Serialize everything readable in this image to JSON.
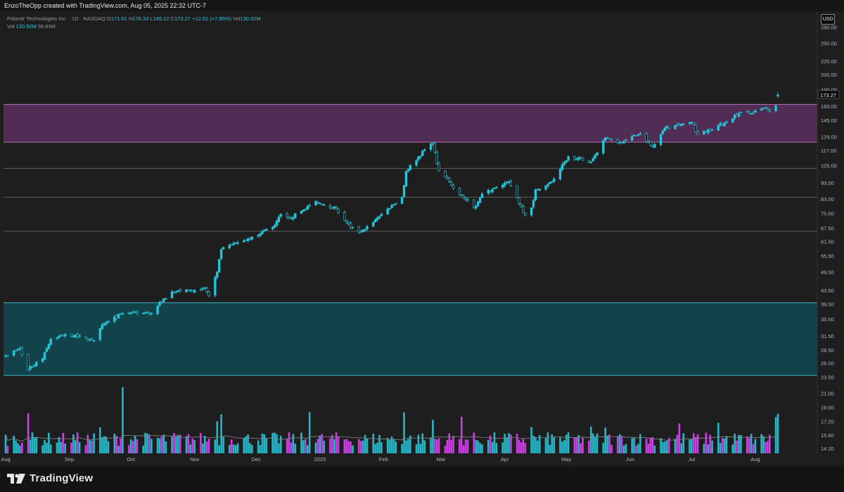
{
  "header": {
    "attribution": "EnzoTheOpp created with TradingView.com, Aug 05, 2025 22:32 UTC-7"
  },
  "legend": {
    "symbol": "Palantir Technologies Inc. · 1D · NASDAQ",
    "open_label": "O",
    "open": "171.81",
    "high_label": "H",
    "high": "176.33",
    "low_label": "L",
    "low": "169.22",
    "close_label": "C",
    "close": "173.27",
    "change": "+12.61 (+7.85%)",
    "vol_label": "Vol",
    "vol": "130.92M",
    "vol2_label": "Vol",
    "vol2": "130.92M",
    "vol_ma": "59.83M"
  },
  "currency": "USD",
  "last_price": "173.27",
  "footer": {
    "brand": "TradingView"
  },
  "colors": {
    "up": "#26c6da",
    "down": "#26c6da",
    "vol_up": "#26c6da",
    "vol_down": "#e040fb",
    "zone_top": "#5b2f5e",
    "zone_bottom": "#124a52",
    "level_line": "#5e5e5e"
  },
  "chart_data": {
    "type": "candlestick",
    "y_scale": "log",
    "y_ticks": [
      280.0,
      250.0,
      220.0,
      200.0,
      180.0,
      160.0,
      145.0,
      129.0,
      117.0,
      105.0,
      93.0,
      83.0,
      75.0,
      67.5,
      61.5,
      55.5,
      49.5,
      43.5,
      39.5,
      35.5,
      31.5,
      28.5,
      26.0,
      23.5,
      21.0,
      19.0,
      17.2,
      15.6,
      14.2
    ],
    "y_tick_labels": [
      "280.00",
      "250.00",
      "220.00",
      "200.00",
      "180.00",
      "160.00",
      "145.00",
      "129.00",
      "117.00",
      "105.00",
      "93.00",
      "83.00",
      "75.00",
      "67.50",
      "61.50",
      "55.50",
      "49.50",
      "43.50",
      "39.50",
      "35.50",
      "31.50",
      "28.50",
      "26.00",
      "23.50",
      "21.00",
      "19.00",
      "17.20",
      "15.60",
      "14.20"
    ],
    "x_labels": [
      "Aug",
      "Sep",
      "Oct",
      "Nov",
      "Dec",
      "2025",
      "Feb",
      "Mar",
      "Apr",
      "May",
      "Jun",
      "Jul",
      "Aug"
    ],
    "x_label_days": [
      0,
      31,
      61,
      92,
      122,
      153,
      184,
      212,
      243,
      273,
      304,
      334,
      365
    ],
    "date_range": [
      "2024-07-25",
      "2025-08-05"
    ],
    "zones": [
      {
        "low": 124,
        "high": 162
      },
      {
        "low": 23.8,
        "high": 39.8
      }
    ],
    "levels": [
      103,
      84,
      66
    ],
    "key_points": [
      {
        "date": "2024-07-25",
        "close": 27.3
      },
      {
        "date": "2024-08-01",
        "close": 28.8
      },
      {
        "date": "2024-08-05",
        "close": 24.9
      },
      {
        "date": "2024-08-12",
        "close": 26.8
      },
      {
        "date": "2024-08-16",
        "close": 30.8
      },
      {
        "date": "2024-08-23",
        "close": 31.8
      },
      {
        "date": "2024-08-30",
        "close": 31.5
      },
      {
        "date": "2024-09-06",
        "close": 30.5
      },
      {
        "date": "2024-09-10",
        "close": 34.0
      },
      {
        "date": "2024-09-20",
        "close": 36.9
      },
      {
        "date": "2024-10-04",
        "close": 37.0
      },
      {
        "date": "2024-10-10",
        "close": 41.0
      },
      {
        "date": "2024-10-14",
        "close": 43.0
      },
      {
        "date": "2024-10-25",
        "close": 43.5
      },
      {
        "date": "2024-10-30",
        "close": 44.2
      },
      {
        "date": "2024-11-01",
        "close": 41.8
      },
      {
        "date": "2024-11-05",
        "close": 49.5
      },
      {
        "date": "2024-11-07",
        "close": 58.0
      },
      {
        "date": "2024-11-22",
        "close": 63.5
      },
      {
        "date": "2024-12-03",
        "close": 68.8
      },
      {
        "date": "2024-12-06",
        "close": 74.5
      },
      {
        "date": "2024-12-10",
        "close": 72.0
      },
      {
        "date": "2024-12-23",
        "close": 81.5
      },
      {
        "date": "2025-01-02",
        "close": 77.5
      },
      {
        "date": "2025-01-09",
        "close": 67.7
      },
      {
        "date": "2025-01-14",
        "close": 65.5
      },
      {
        "date": "2025-01-24",
        "close": 74.5
      },
      {
        "date": "2025-02-03",
        "close": 84.0
      },
      {
        "date": "2025-02-05",
        "close": 101.0
      },
      {
        "date": "2025-02-14",
        "close": 117.5
      },
      {
        "date": "2025-02-18",
        "close": 123.0
      },
      {
        "date": "2025-02-21",
        "close": 101.0
      },
      {
        "date": "2025-03-04",
        "close": 85.0
      },
      {
        "date": "2025-03-10",
        "close": 78.0
      },
      {
        "date": "2025-03-14",
        "close": 86.0
      },
      {
        "date": "2025-03-21",
        "close": 90.0
      },
      {
        "date": "2025-03-27",
        "close": 94.0
      },
      {
        "date": "2025-04-04",
        "close": 74.0
      },
      {
        "date": "2025-04-07",
        "close": 78.0
      },
      {
        "date": "2025-04-09",
        "close": 88.5
      },
      {
        "date": "2025-04-17",
        "close": 93.8
      },
      {
        "date": "2025-04-25",
        "close": 112.0
      },
      {
        "date": "2025-05-06",
        "close": 108.0
      },
      {
        "date": "2025-05-13",
        "close": 128.0
      },
      {
        "date": "2025-05-20",
        "close": 124.0
      },
      {
        "date": "2025-05-30",
        "close": 131.8
      },
      {
        "date": "2025-06-05",
        "close": 119.9
      },
      {
        "date": "2025-06-11",
        "close": 137.0
      },
      {
        "date": "2025-06-18",
        "close": 140.0
      },
      {
        "date": "2025-06-24",
        "close": 143.0
      },
      {
        "date": "2025-06-27",
        "close": 130.6
      },
      {
        "date": "2025-07-10",
        "close": 142.0
      },
      {
        "date": "2025-07-18",
        "close": 153.5
      },
      {
        "date": "2025-07-23",
        "close": 152.0
      },
      {
        "date": "2025-07-30",
        "close": 157.9
      },
      {
        "date": "2025-08-01",
        "close": 154.3
      },
      {
        "date": "2025-08-04",
        "close": 160.7
      },
      {
        "date": "2025-08-05",
        "open": 171.81,
        "high": 176.33,
        "low": 169.22,
        "close": 173.27
      }
    ],
    "volume_spikes": [
      {
        "date": "2024-08-05",
        "value": 132
      },
      {
        "date": "2024-09-09",
        "value": 86
      },
      {
        "date": "2024-09-20",
        "value": 219
      },
      {
        "date": "2024-11-05",
        "value": 106
      },
      {
        "date": "2024-11-07",
        "value": 129
      },
      {
        "date": "2024-12-20",
        "value": 136
      },
      {
        "date": "2025-02-04",
        "value": 136
      },
      {
        "date": "2025-02-18",
        "value": 111
      },
      {
        "date": "2025-03-04",
        "value": 121
      },
      {
        "date": "2025-04-07",
        "value": 87
      },
      {
        "date": "2025-05-06",
        "value": 89
      },
      {
        "date": "2025-05-13",
        "value": 85
      },
      {
        "date": "2025-06-18",
        "value": 99
      },
      {
        "date": "2025-07-07",
        "value": 101
      },
      {
        "date": "2025-08-04",
        "value": 120
      },
      {
        "date": "2025-08-05",
        "value": 130.92
      }
    ],
    "volume_ma_last": 59.83
  }
}
